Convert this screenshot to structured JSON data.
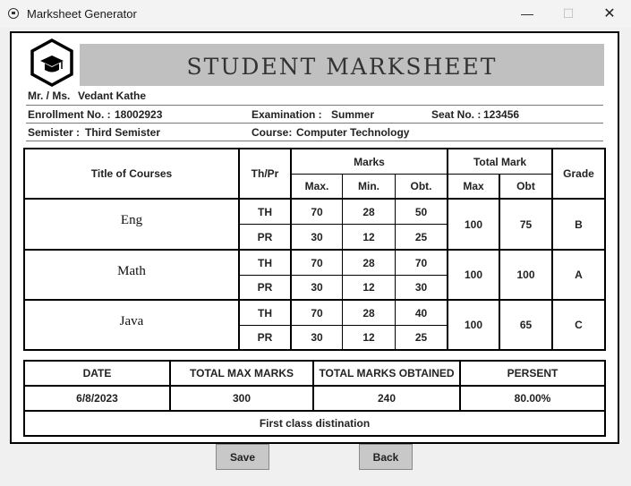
{
  "window": {
    "title": "Marksheet Generator",
    "minimize_glyph": "—",
    "maximize_glyph": "☐",
    "close_glyph": "✕"
  },
  "header": {
    "title": "STUDENT MARKSHEET"
  },
  "student": {
    "name_label": "Mr. / Ms.",
    "name": "Vedant Kathe",
    "enroll_label": "Enrollment No. :",
    "enroll": "18002923",
    "exam_label": "Examination  :",
    "exam": "Summer",
    "seat_label": "Seat No. :",
    "seat": "123456",
    "sem_label": "Semister :",
    "sem": "Third Semister",
    "course_label": "Course:",
    "course": "Computer Technology"
  },
  "table": {
    "head": {
      "title": "Title of Courses",
      "thpr": "Th/Pr",
      "marks": "Marks",
      "max": "Max.",
      "min": "Min.",
      "obt": "Obt.",
      "total": "Total Mark",
      "tmax": "Max",
      "tobt": "Obt",
      "grade": "Grade"
    },
    "subjects": [
      {
        "name": "Eng",
        "rows": [
          {
            "type": "TH",
            "max": "70",
            "min": "28",
            "obt": "50"
          },
          {
            "type": "PR",
            "max": "30",
            "min": "12",
            "obt": "25"
          }
        ],
        "total_max": "100",
        "total_obt": "75",
        "grade": "B"
      },
      {
        "name": "Math",
        "rows": [
          {
            "type": "TH",
            "max": "70",
            "min": "28",
            "obt": "70"
          },
          {
            "type": "PR",
            "max": "30",
            "min": "12",
            "obt": "30"
          }
        ],
        "total_max": "100",
        "total_obt": "100",
        "grade": "A"
      },
      {
        "name": "Java",
        "rows": [
          {
            "type": "TH",
            "max": "70",
            "min": "28",
            "obt": "40"
          },
          {
            "type": "PR",
            "max": "30",
            "min": "12",
            "obt": "25"
          }
        ],
        "total_max": "100",
        "total_obt": "65",
        "grade": "C"
      }
    ]
  },
  "summary": {
    "date_label": "DATE",
    "max_label": "TOTAL MAX MARKS",
    "obt_label": "TOTAL MARKS OBTAINED",
    "pct_label": "PERSENT",
    "date": "6/8/2023",
    "max": "300",
    "obt": "240",
    "pct": "80.00%",
    "result": "First class distination"
  },
  "buttons": {
    "save": "Save",
    "back": "Back"
  }
}
